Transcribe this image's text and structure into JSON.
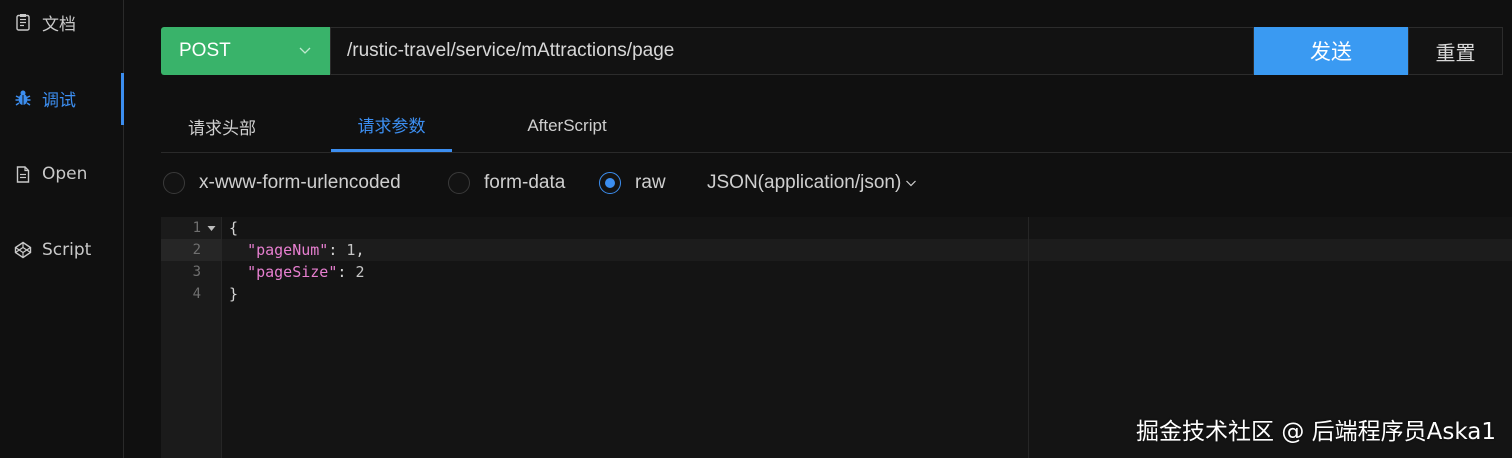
{
  "sidebar": {
    "items": [
      {
        "label": "文档",
        "icon": "document-icon"
      },
      {
        "label": "调试",
        "icon": "bug-icon",
        "active": true
      },
      {
        "label": "Open",
        "icon": "file-icon"
      },
      {
        "label": "Script",
        "icon": "codepen-icon"
      }
    ]
  },
  "request": {
    "method": "POST",
    "url": "/rustic-travel/service/mAttractions/page",
    "send_label": "发送",
    "reset_label": "重置"
  },
  "tabs": [
    {
      "label": "请求头部"
    },
    {
      "label": "请求参数",
      "active": true
    },
    {
      "label": "AfterScript"
    }
  ],
  "body_types": [
    {
      "label": "x-www-form-urlencoded",
      "checked": false
    },
    {
      "label": "form-data",
      "checked": false
    },
    {
      "label": "raw",
      "checked": true
    }
  ],
  "content_type": "JSON(application/json)",
  "editor": {
    "line_numbers": [
      "1",
      "2",
      "3",
      "4"
    ],
    "lines": [
      {
        "key": "",
        "punct_before": "{",
        "value": "",
        "punct_after": ""
      },
      {
        "key": "\"pageNum\"",
        "punct_before": "  ",
        "value": "1",
        "punct_after": ","
      },
      {
        "key": "\"pageSize\"",
        "punct_before": "  ",
        "value": "2",
        "punct_after": ""
      },
      {
        "key": "",
        "punct_before": "}",
        "value": "",
        "punct_after": ""
      }
    ]
  },
  "watermark": "掘金技术社区 @ 后端程序员Aska1",
  "colors": {
    "accent": "#3c8ef0",
    "method_green": "#39b36a",
    "send_blue": "#3a9af2",
    "json_key": "#e77fd0"
  }
}
